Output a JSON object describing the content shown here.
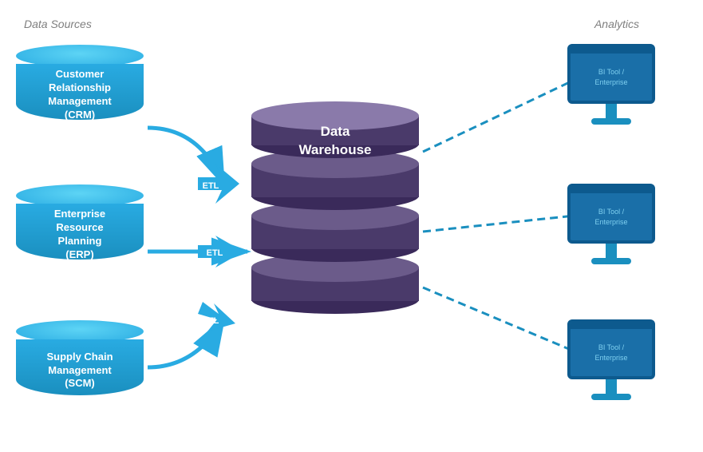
{
  "labels": {
    "data_sources": "Data Sources",
    "analytics": "Analytics"
  },
  "sources": [
    {
      "id": "crm",
      "line1": "Customer",
      "line2": "Relationship",
      "line3": "Management",
      "line4": "(CRM)"
    },
    {
      "id": "erp",
      "line1": "Enterprise",
      "line2": "Resource",
      "line3": "Planning",
      "line4": "(ERP)"
    },
    {
      "id": "scm",
      "line1": "Supply Chain",
      "line2": "Management",
      "line3": "(SCM)"
    }
  ],
  "warehouse": {
    "line1": "Data",
    "line2": "Warehouse"
  },
  "etl": {
    "label": "ETL"
  },
  "monitors": [
    {
      "id": "monitor-1",
      "line1": "BI Tool /",
      "line2": "Enterprise"
    },
    {
      "id": "monitor-2",
      "line1": "BI Tool /",
      "line2": "Enterprise"
    },
    {
      "id": "monitor-3",
      "line1": "BI Tool /",
      "line2": "Enterprise"
    }
  ],
  "colors": {
    "blue": "#29abe2",
    "blue_dark": "#1a6fa8",
    "purple": "#6b5b8a",
    "purple_dark": "#4a3a6a",
    "white": "#ffffff",
    "dashed": "#1a8fbf"
  }
}
